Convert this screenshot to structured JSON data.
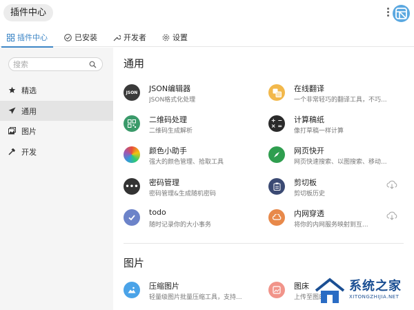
{
  "header": {
    "title": "插件中心"
  },
  "tabs": [
    {
      "label": "插件中心",
      "icon": "grid-icon",
      "active": true
    },
    {
      "label": "已安装",
      "icon": "check-circle-icon"
    },
    {
      "label": "开发者",
      "icon": "wrench-icon"
    },
    {
      "label": "设置",
      "icon": "gear-icon"
    }
  ],
  "sidebar": {
    "search_placeholder": "搜索",
    "items": [
      {
        "label": "精选",
        "icon": "star-icon"
      },
      {
        "label": "通用",
        "icon": "paper-plane-icon",
        "active": true
      },
      {
        "label": "图片",
        "icon": "image-icon"
      },
      {
        "label": "开发",
        "icon": "hammer-icon"
      }
    ]
  },
  "sections": [
    {
      "title": "通用",
      "plugins": [
        {
          "name": "JSON编辑器",
          "desc": "JSON格式化处理",
          "icon": "json-icon",
          "color": "#3a3a3a",
          "badge": "JSON"
        },
        {
          "name": "在线翻译",
          "desc": "一个非常轻巧的翻译工具，不巧...",
          "icon": "translate-icon",
          "color": "#f2b84b"
        },
        {
          "name": "二维码处理",
          "desc": "二维码生成解析",
          "icon": "qrcode-icon",
          "color": "#3a9a6a"
        },
        {
          "name": "计算稿纸",
          "desc": "像打草稿一样计算",
          "icon": "calculator-icon",
          "color": "#2a2a2a"
        },
        {
          "name": "颜色小助手",
          "desc": "强大的颜色管理、拾取工具",
          "icon": "color-wheel-icon"
        },
        {
          "name": "网页快开",
          "desc": "网页快速搜索、以图搜索、移动...",
          "icon": "compass-icon",
          "color": "#2f9e4f"
        },
        {
          "name": "密码管理",
          "desc": "密码管理&生成随机密码",
          "icon": "password-icon",
          "color": "#333333"
        },
        {
          "name": "剪切板",
          "desc": "剪切板历史",
          "icon": "clipboard-icon",
          "color": "#3b4a73"
        },
        {
          "name": "todo",
          "desc": "随时记录你的大小事务",
          "icon": "todo-check-icon",
          "color": "#6c83c9"
        },
        {
          "name": "内网穿透",
          "desc": "将你的内网服务映射到互...",
          "icon": "tunnel-icon",
          "color": "#e8894a"
        }
      ]
    },
    {
      "title": "图片",
      "plugins": [
        {
          "name": "压缩图片",
          "desc": "轻量级图片批量压缩工具，支持...",
          "icon": "compress-image-icon",
          "color": "#4aa3e8"
        },
        {
          "name": "图床",
          "desc": "上传至图床",
          "icon": "image-host-icon",
          "color": "#f1948a"
        }
      ]
    }
  ],
  "watermark": {
    "text": "系统之家",
    "sub": "XITONGZHIJIA.NET"
  }
}
